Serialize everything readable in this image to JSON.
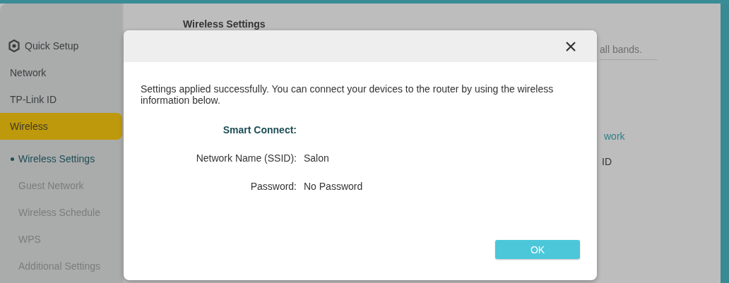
{
  "sidebar": {
    "items": [
      {
        "label": "Quick Setup",
        "kind": "icon",
        "selected": false
      },
      {
        "label": "Network",
        "kind": "plain",
        "selected": false
      },
      {
        "label": "TP-Link ID",
        "kind": "plain",
        "selected": false
      },
      {
        "label": "Wireless",
        "kind": "plain",
        "selected": true
      }
    ],
    "subitems": [
      {
        "label": "Wireless Settings",
        "selected": true
      },
      {
        "label": "Guest Network",
        "selected": false
      },
      {
        "label": "Wireless Schedule",
        "selected": false
      },
      {
        "label": "WPS",
        "selected": false
      },
      {
        "label": "Additional Settings",
        "selected": false
      }
    ]
  },
  "page": {
    "heading": "Wireless Settings",
    "fragments": [
      {
        "text": "all bands.",
        "kind": "hint"
      },
      {
        "text": "work",
        "kind": "link"
      },
      {
        "text": "ID",
        "kind": "text"
      }
    ]
  },
  "dialog": {
    "message": "Settings applied successfully. You can connect your devices to the router by using the wireless information below.",
    "section": "Smart Connect:",
    "fields": [
      {
        "label": "Network Name (SSID):",
        "value": "Salon"
      },
      {
        "label": "Password:",
        "value": "No Password"
      }
    ],
    "button": "OK"
  }
}
